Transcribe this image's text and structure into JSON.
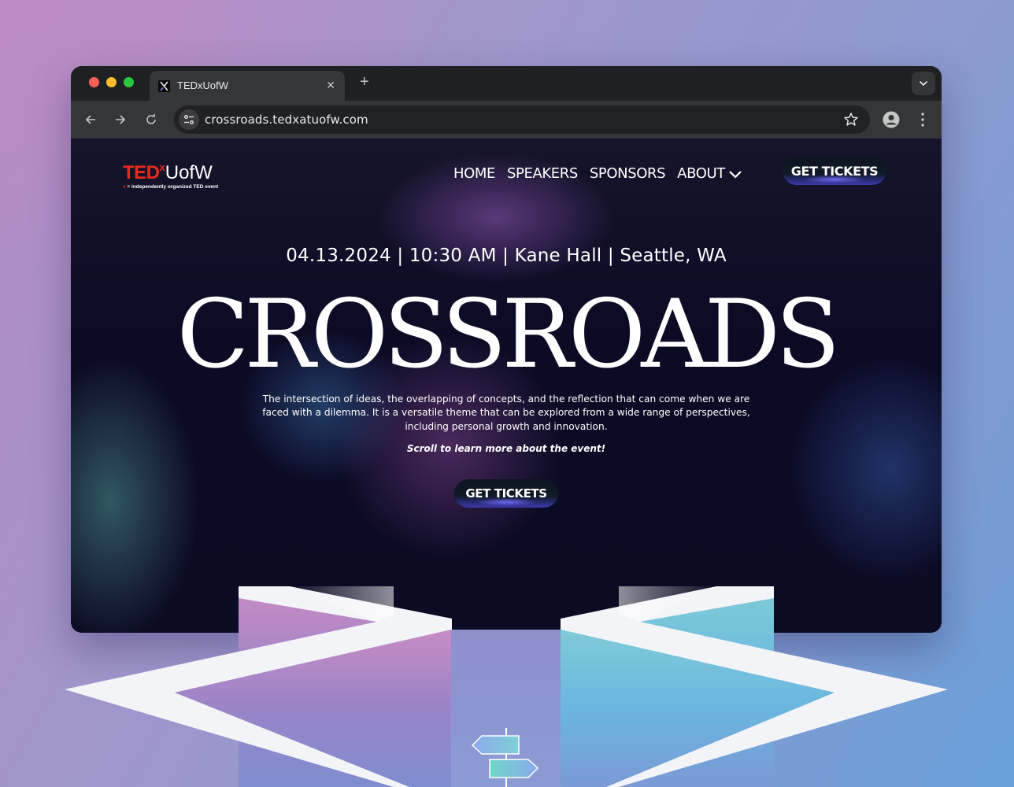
{
  "browser": {
    "tab_title": "TEDxUofW",
    "tab_close": "✕",
    "new_tab": "+",
    "url": "crossroads.tedxatuofw.com"
  },
  "site": {
    "logo": {
      "ted": "TED",
      "x": "x",
      "name": "UofW",
      "tagline_x": "x",
      "tagline": " = independently organized TED event"
    },
    "nav": {
      "home": "HOME",
      "speakers": "SPEAKERS",
      "sponsors": "SPONSORS",
      "about": "ABOUT"
    },
    "header_cta": "GET TICKETS",
    "event_info": "04.13.2024 | 10:30 AM | Kane Hall | Seattle, WA",
    "title": "CROSSROADS",
    "description": "The intersection of ideas, the overlapping of concepts, and the reflection that can come when we are faced with a dilemma. It is a versatile theme that can be explored from a wide range of perspectives, including personal growth and innovation.",
    "scroll_note": "Scroll to learn more about the event!",
    "hero_cta": "GET TICKETS"
  },
  "colors": {
    "ted_red": "#e62b1e",
    "page_bg": "#0c0b24",
    "chrome_dark": "#1f2022",
    "chrome_toolbar": "#35363a"
  },
  "icons": [
    "back-arrow-icon",
    "forward-arrow-icon",
    "reload-icon",
    "site-settings-icon",
    "bookmark-star-icon",
    "profile-icon",
    "more-menu-icon",
    "chevron-down-icon",
    "signpost-icon"
  ]
}
